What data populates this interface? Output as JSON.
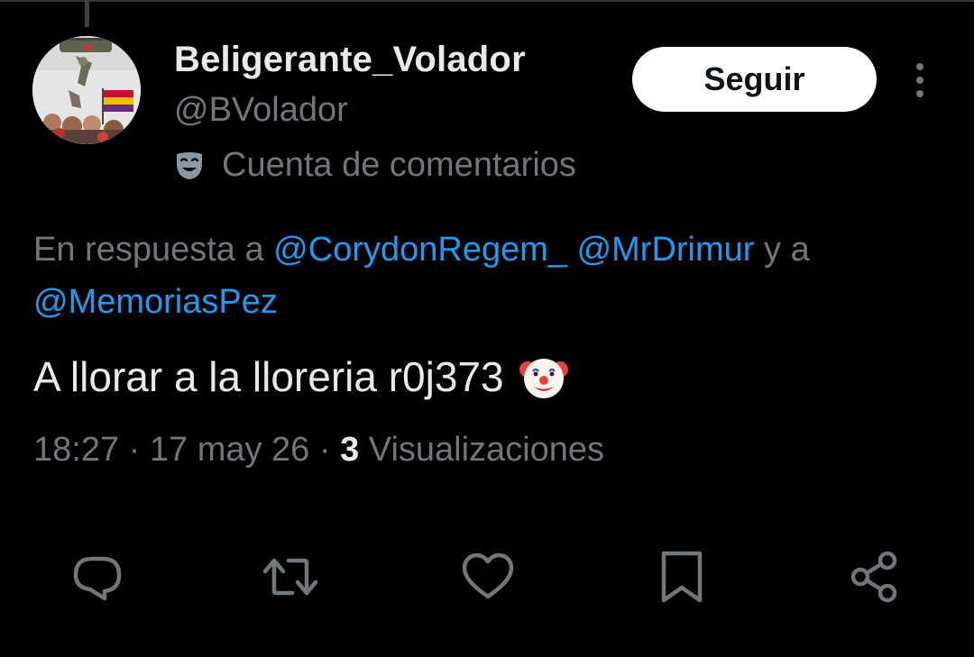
{
  "tweet": {
    "author": {
      "display_name": "Beligerante_Volador",
      "handle": "@BVolador",
      "account_label": "Cuenta de comentarios",
      "account_label_icon": "mask-icon"
    },
    "follow_label": "Seguir",
    "reply_to": {
      "prefix": "En respuesta a ",
      "mentions": [
        "@CorydonRegem_",
        "@MrDrimur",
        "@MemoriasPez"
      ],
      "connector": " y a "
    },
    "text": "A llorar a la lloreria r0j373",
    "emoji_icon": "clown-face-icon",
    "time": "18:27",
    "separator": " · ",
    "date": "17 may 26",
    "views_count": "3",
    "views_label": " Visualizaciones"
  },
  "actions": [
    {
      "name": "reply",
      "icon": "comment-icon"
    },
    {
      "name": "retweet",
      "icon": "retweet-icon"
    },
    {
      "name": "like",
      "icon": "heart-icon"
    },
    {
      "name": "bookmark",
      "icon": "bookmark-icon"
    },
    {
      "name": "share",
      "icon": "share-icon"
    }
  ],
  "colors": {
    "background": "#000000",
    "primary_text": "#e7e9ea",
    "secondary_text": "#71767b",
    "link": "#1d9bf0",
    "follow_button_bg": "#ffffff"
  }
}
